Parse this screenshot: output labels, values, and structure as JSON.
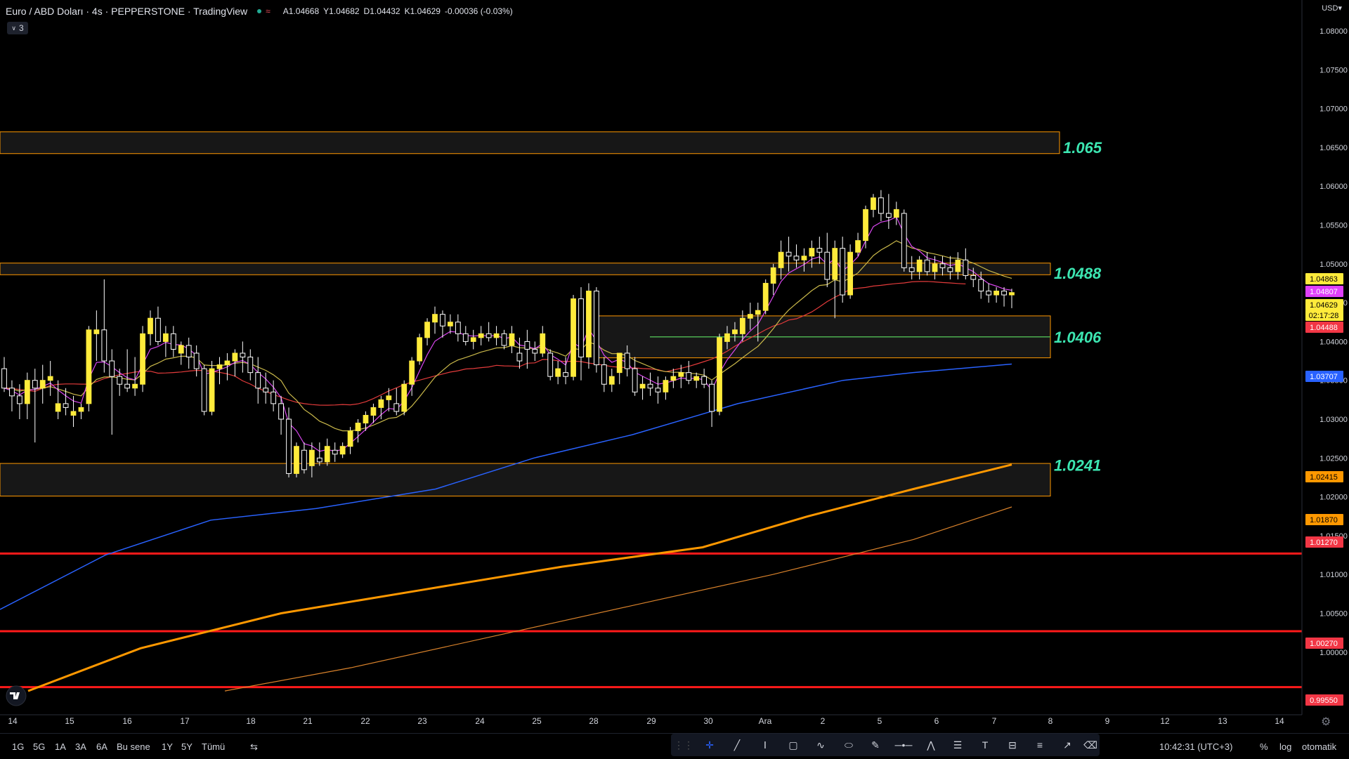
{
  "header": {
    "title": "Euro / ABD Doları · 4s · PEPPERSTONE · TradingView",
    "open": "A1.04668",
    "high": "Y1.04682",
    "low": "D1.04432",
    "close": "K1.04629",
    "change": "-0.00036 (-0.03%)",
    "legend_count": "3"
  },
  "currency": "USD",
  "chart_data": {
    "type": "candlestick",
    "title": "Euro / ABD Doları · 4s · PEPPERSTONE · TradingView",
    "x_labels": [
      "14",
      "15",
      "16",
      "17",
      "18",
      "21",
      "22",
      "23",
      "24",
      "25",
      "28",
      "29",
      "30",
      "Ara",
      "2",
      "5",
      "6",
      "7",
      "8",
      "9",
      "12",
      "13",
      "14"
    ],
    "y_ticks": [
      "1.08000",
      "1.07500",
      "1.07000",
      "1.06500",
      "1.06000",
      "1.05500",
      "1.05000",
      "1.04500",
      "1.04000",
      "1.03500",
      "1.03000",
      "1.02500",
      "1.02000",
      "1.01500",
      "1.01000",
      "1.00500",
      "1.00000"
    ],
    "ylim": [
      0.9941,
      1.0846
    ],
    "price_tags": [
      {
        "label": "1.04863",
        "bg": "#ffeb3b",
        "fg": "#000000"
      },
      {
        "label": "1.04807",
        "bg": "#e040fb",
        "fg": "#ffffff"
      },
      {
        "label": "1.04629",
        "bg": "#ffeb3b",
        "fg": "#000000"
      },
      {
        "label": "02:17:28",
        "bg": "#ffeb3b",
        "fg": "#000000"
      },
      {
        "label": "1.04488",
        "bg": "#f23645",
        "fg": "#ffffff"
      },
      {
        "label": "1.03707",
        "bg": "#2962ff",
        "fg": "#ffffff"
      },
      {
        "label": "1.02415",
        "bg": "#ff9800",
        "fg": "#000000"
      },
      {
        "label": "1.01870",
        "bg": "#ff9800",
        "fg": "#000000"
      },
      {
        "label": "1.01270",
        "bg": "#f23645",
        "fg": "#ffffff"
      },
      {
        "label": "1.00270",
        "bg": "#f23645",
        "fg": "#ffffff"
      },
      {
        "label": "0.99550",
        "bg": "#f23645",
        "fg": "#ffffff"
      }
    ],
    "hlines": [
      1.0127,
      1.0027,
      0.9955
    ],
    "level_labels": [
      {
        "text": "1.065",
        "price": 1.065
      },
      {
        "text": "1.0488",
        "price": 1.0488
      },
      {
        "text": "1.0406",
        "price": 1.0406
      },
      {
        "text": "1.0241",
        "price": 1.0241
      }
    ],
    "zones": [
      {
        "top": 1.067,
        "bottom": 1.0642
      },
      {
        "top": 1.0501,
        "bottom": 1.0486
      },
      {
        "top": 1.0433,
        "bottom": 1.0379
      },
      {
        "top": 1.0243,
        "bottom": 1.0201
      }
    ],
    "green_line": 1.0406,
    "candles": [
      [
        1.0365,
        1.038,
        1.0335,
        1.034
      ],
      [
        1.034,
        1.035,
        1.031,
        1.033
      ],
      [
        1.033,
        1.0345,
        1.03,
        1.032
      ],
      [
        1.032,
        1.036,
        1.03,
        1.035
      ],
      [
        1.035,
        1.0365,
        1.027,
        1.034
      ],
      [
        1.034,
        1.037,
        1.032,
        1.035
      ],
      [
        1.035,
        1.0375,
        1.033,
        1.0355
      ],
      [
        1.031,
        1.035,
        1.03,
        1.032
      ],
      [
        1.032,
        1.034,
        1.0305,
        1.0315
      ],
      [
        1.0305,
        1.033,
        1.029,
        1.031
      ],
      [
        1.031,
        1.032,
        1.03,
        1.0315
      ],
      [
        1.032,
        1.042,
        1.031,
        1.0415
      ],
      [
        1.041,
        1.044,
        1.0375,
        1.0415
      ],
      [
        1.0415,
        1.048,
        1.036,
        1.0375
      ],
      [
        1.0375,
        1.039,
        1.028,
        1.0355
      ],
      [
        1.0355,
        1.0365,
        1.033,
        1.0345
      ],
      [
        1.0345,
        1.039,
        1.0335,
        1.034
      ],
      [
        1.034,
        1.038,
        1.033,
        1.0345
      ],
      [
        1.0345,
        1.042,
        1.0335,
        1.041
      ],
      [
        1.041,
        1.044,
        1.0395,
        1.043
      ],
      [
        1.043,
        1.0445,
        1.0395,
        1.04
      ],
      [
        1.04,
        1.042,
        1.038,
        1.041
      ],
      [
        1.041,
        1.042,
        1.038,
        1.039
      ],
      [
        1.0385,
        1.04,
        1.037,
        1.0395
      ],
      [
        1.0395,
        1.0405,
        1.0365,
        1.038
      ],
      [
        1.0385,
        1.0395,
        1.0355,
        1.0365
      ],
      [
        1.0365,
        1.037,
        1.0305,
        1.031
      ],
      [
        1.031,
        1.0375,
        1.0305,
        1.0365
      ],
      [
        1.0365,
        1.038,
        1.0345,
        1.037
      ],
      [
        1.037,
        1.0385,
        1.035,
        1.0375
      ],
      [
        1.0375,
        1.039,
        1.0355,
        1.0385
      ],
      [
        1.0385,
        1.04,
        1.036,
        1.038
      ],
      [
        1.038,
        1.039,
        1.035,
        1.036
      ],
      [
        1.036,
        1.038,
        1.032,
        1.034
      ],
      [
        1.034,
        1.036,
        1.032,
        1.0335
      ],
      [
        1.0335,
        1.035,
        1.031,
        1.032
      ],
      [
        1.032,
        1.033,
        1.028,
        1.03
      ],
      [
        1.03,
        1.0315,
        1.0225,
        1.023
      ],
      [
        1.023,
        1.027,
        1.0225,
        1.0265
      ],
      [
        1.026,
        1.027,
        1.023,
        1.0235
      ],
      [
        1.024,
        1.027,
        1.0225,
        1.026
      ],
      [
        1.025,
        1.027,
        1.024,
        1.0245
      ],
      [
        1.0245,
        1.0275,
        1.024,
        1.0265
      ],
      [
        1.026,
        1.027,
        1.0245,
        1.0255
      ],
      [
        1.0255,
        1.027,
        1.025,
        1.0265
      ],
      [
        1.0265,
        1.029,
        1.0255,
        1.0285
      ],
      [
        1.0285,
        1.03,
        1.027,
        1.0295
      ],
      [
        1.0295,
        1.031,
        1.0285,
        1.0305
      ],
      [
        1.0305,
        1.032,
        1.0295,
        1.0315
      ],
      [
        1.0315,
        1.033,
        1.03,
        1.0325
      ],
      [
        1.0325,
        1.034,
        1.031,
        1.033
      ],
      [
        1.032,
        1.034,
        1.0305,
        1.031
      ],
      [
        1.031,
        1.035,
        1.0305,
        1.0345
      ],
      [
        1.0345,
        1.038,
        1.033,
        1.0375
      ],
      [
        1.0375,
        1.041,
        1.037,
        1.0405
      ],
      [
        1.0405,
        1.043,
        1.0395,
        1.0425
      ],
      [
        1.0425,
        1.0445,
        1.041,
        1.0435
      ],
      [
        1.0435,
        1.044,
        1.0405,
        1.042
      ],
      [
        1.042,
        1.0435,
        1.041,
        1.0425
      ],
      [
        1.0425,
        1.0435,
        1.04,
        1.041
      ],
      [
        1.041,
        1.042,
        1.0395,
        1.04
      ],
      [
        1.04,
        1.0415,
        1.039,
        1.0405
      ],
      [
        1.0405,
        1.042,
        1.0395,
        1.041
      ],
      [
        1.041,
        1.0425,
        1.04,
        1.0405
      ],
      [
        1.0405,
        1.042,
        1.0395,
        1.041
      ],
      [
        1.041,
        1.0415,
        1.039,
        1.0395
      ],
      [
        1.0395,
        1.042,
        1.0385,
        1.041
      ],
      [
        1.0385,
        1.0405,
        1.0365,
        1.0375
      ],
      [
        1.04,
        1.0415,
        1.0365,
        1.039
      ],
      [
        1.039,
        1.04,
        1.0375,
        1.0385
      ],
      [
        1.0385,
        1.042,
        1.038,
        1.041
      ],
      [
        1.0385,
        1.039,
        1.035,
        1.0355
      ],
      [
        1.0355,
        1.0375,
        1.0345,
        1.0365
      ],
      [
        1.036,
        1.038,
        1.0345,
        1.0355
      ],
      [
        1.0355,
        1.046,
        1.035,
        1.0455
      ],
      [
        1.0455,
        1.047,
        1.035,
        1.038
      ],
      [
        1.038,
        1.0475,
        1.0365,
        1.0465
      ],
      [
        1.0465,
        1.047,
        1.036,
        1.037
      ],
      [
        1.037,
        1.038,
        1.0335,
        1.0345
      ],
      [
        1.0345,
        1.0365,
        1.0335,
        1.0355
      ],
      [
        1.036,
        1.0385,
        1.0345,
        1.0385
      ],
      [
        1.0385,
        1.0395,
        1.0355,
        1.0365
      ],
      [
        1.0365,
        1.038,
        1.033,
        1.0335
      ],
      [
        1.034,
        1.0355,
        1.0325,
        1.0345
      ],
      [
        1.0345,
        1.036,
        1.033,
        1.034
      ],
      [
        1.034,
        1.0355,
        1.032,
        1.0335
      ],
      [
        1.0335,
        1.0355,
        1.0325,
        1.035
      ],
      [
        1.035,
        1.0365,
        1.034,
        1.0355
      ],
      [
        1.0355,
        1.037,
        1.034,
        1.036
      ],
      [
        1.036,
        1.0375,
        1.0345,
        1.035
      ],
      [
        1.035,
        1.036,
        1.034,
        1.0355
      ],
      [
        1.0355,
        1.0365,
        1.034,
        1.0345
      ],
      [
        1.0345,
        1.035,
        1.029,
        1.031
      ],
      [
        1.031,
        1.041,
        1.0305,
        1.0405
      ],
      [
        1.04,
        1.042,
        1.039,
        1.041
      ],
      [
        1.041,
        1.0425,
        1.04,
        1.0415
      ],
      [
        1.041,
        1.044,
        1.04,
        1.043
      ],
      [
        1.043,
        1.045,
        1.0415,
        1.0435
      ],
      [
        1.0435,
        1.045,
        1.04,
        1.044
      ],
      [
        1.044,
        1.048,
        1.0435,
        1.0475
      ],
      [
        1.0475,
        1.05,
        1.046,
        1.0495
      ],
      [
        1.0495,
        1.053,
        1.048,
        1.0515
      ],
      [
        1.0515,
        1.0535,
        1.049,
        1.051
      ],
      [
        1.051,
        1.0525,
        1.0495,
        1.0505
      ],
      [
        1.0505,
        1.052,
        1.049,
        1.051
      ],
      [
        1.051,
        1.053,
        1.0495,
        1.052
      ],
      [
        1.052,
        1.0535,
        1.05,
        1.0515
      ],
      [
        1.0515,
        1.054,
        1.047,
        1.048
      ],
      [
        1.048,
        1.053,
        1.043,
        1.052
      ],
      [
        1.052,
        1.0535,
        1.045,
        1.046
      ],
      [
        1.046,
        1.0525,
        1.0455,
        1.0515
      ],
      [
        1.0515,
        1.054,
        1.051,
        1.053
      ],
      [
        1.053,
        1.0575,
        1.052,
        1.057
      ],
      [
        1.057,
        1.059,
        1.056,
        1.0585
      ],
      [
        1.0585,
        1.0595,
        1.0555,
        1.0565
      ],
      [
        1.0565,
        1.059,
        1.0545,
        1.056
      ],
      [
        1.056,
        1.058,
        1.055,
        1.057
      ],
      [
        1.0565,
        1.057,
        1.049,
        1.0495
      ],
      [
        1.0495,
        1.051,
        1.048,
        1.049
      ],
      [
        1.049,
        1.051,
        1.048,
        1.0505
      ],
      [
        1.0505,
        1.0515,
        1.0485,
        1.049
      ],
      [
        1.049,
        1.051,
        1.048,
        1.05
      ],
      [
        1.05,
        1.051,
        1.0485,
        1.0495
      ],
      [
        1.0495,
        1.051,
        1.048,
        1.049
      ],
      [
        1.049,
        1.0515,
        1.048,
        1.0505
      ],
      [
        1.0505,
        1.052,
        1.048,
        1.0485
      ],
      [
        1.0485,
        1.0495,
        1.047,
        1.048
      ],
      [
        1.048,
        1.049,
        1.0455,
        1.0465
      ],
      [
        1.0465,
        1.0475,
        1.045,
        1.046
      ],
      [
        1.046,
        1.047,
        1.045,
        1.0465
      ],
      [
        1.0465,
        1.047,
        1.0445,
        1.046
      ],
      [
        1.046,
        1.0468,
        1.0443,
        1.0463
      ]
    ]
  },
  "ranges": [
    "1G",
    "5G",
    "1A",
    "3A",
    "6A",
    "Bu sene",
    "1Y",
    "5Y",
    "Tümü"
  ],
  "toolbar_icons": [
    "grip-icon",
    "crosshair-icon",
    "trendline-icon",
    "text-cursor-icon",
    "rectangle-icon",
    "brush-icon",
    "ellipse-icon",
    "pen-icon",
    "horizontal-line-icon",
    "path-icon",
    "parallel-channel-icon",
    "text-icon",
    "long-position-icon",
    "fib-icon",
    "arrow-icon",
    "eraser-icon"
  ],
  "status": {
    "clock": "10:42:31 (UTC+3)",
    "percent": "%",
    "log": "log",
    "auto": "otomatik"
  },
  "colors": {
    "up": "#ffeb3b",
    "down": "#000000",
    "outline": "#ffffff",
    "zone_border": "#ff9800",
    "level_label": "#3ce6b1",
    "ema_purple": "#d946ef",
    "ema_yellow": "#c9b84a",
    "ema_red": "#e33b3b",
    "ema_blue": "#2962ff",
    "ema_orange": "#ff9800"
  }
}
